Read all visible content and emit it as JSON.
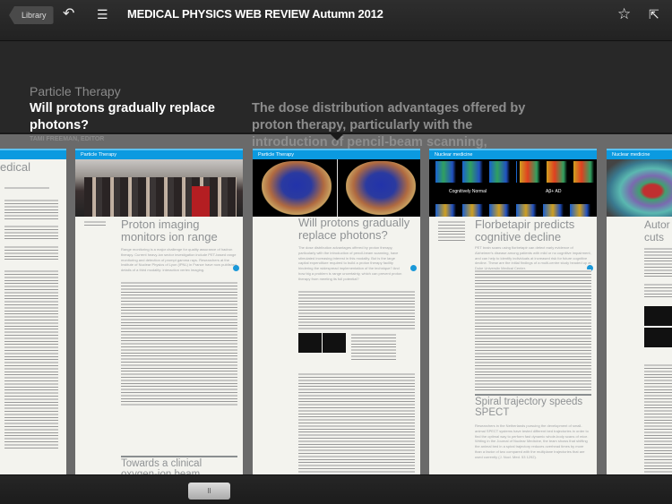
{
  "topbar": {
    "library_label": "Library",
    "title": "MEDICAL PHYSICS WEB REVIEW Autumn 2012",
    "icons": [
      "back-arrow-icon",
      "toc-list-icon",
      "star-icon",
      "share-icon"
    ]
  },
  "info": {
    "section": "Particle Therapy",
    "headline": "Will protons gradually replace photons?",
    "author": "TAMI FREEMAN, EDITOR",
    "lede": "The dose distribution advantages offered by proton therapy, particularly with the introduction of pencil-beam scanning,"
  },
  "pages": [
    {
      "section": "",
      "title": "edical"
    },
    {
      "section": "Particle Therapy",
      "title": "Proton imaging monitors ion range",
      "lede": "Range monitoring is a major challenge for quality assurance of hadron therapy. Current heavy-ion sector investigation include PET-based range monitoring and detection of prompt gamma rays. Researchers at the Institute of Nuclear Physics of Lyon (IPNL) in France have now published details of a third modality: interaction vertex imaging.",
      "title2": "Towards a clinical oxygen-ion beam"
    },
    {
      "section": "Particle Therapy",
      "title": "Will protons gradually replace photons?",
      "lede": "The dose distribution advantages offered by proton therapy, particularly with the introduction of pencil-beam scanning, have stimulated increasing interest in this modality. But is the large capital expenditure required to build a proton therapy facility hindering the widespread implementation of the technique? And how big a problem is range uncertainty, which can prevent proton therapy from meeting its full potential?"
    },
    {
      "section": "Nuclear medicine",
      "title": "Florbetapir predicts cognitive decline",
      "lede": "PET brain scans using florbetapir can detect early evidence of Alzheimer's disease among patients with mild or no cognitive impairment, and can help to identify individuals at increased risk for future cognitive decline. These are the initial findings of a multi-centre study headed up at Duke University Medical Center.",
      "img_label_1": "Cognitively Normal",
      "img_label_2": "Aβ+ AD",
      "title2": "Spiral trajectory speeds SPECT",
      "lede2": "Researchers in the Netherlands pursuing the development of small-animal SPECT systems have tested different bed trajectories in order to find the optimal way to perform fast dynamic whole-body scans of mice. Writing in the Journal of Nuclear Medicine, the team shows that shifting the animal bed in a spiral trajectory reduces overhead times by more than a factor of two compared with the multiplane trajectories that are used currently (J. Nucl. Med. 53 1292)."
    },
    {
      "section": "Nuclear medicine",
      "title": "Autor cuts e"
    }
  ],
  "scrubber": {
    "handle_label": "II"
  },
  "colors": {
    "accent": "#0b9ae0"
  }
}
